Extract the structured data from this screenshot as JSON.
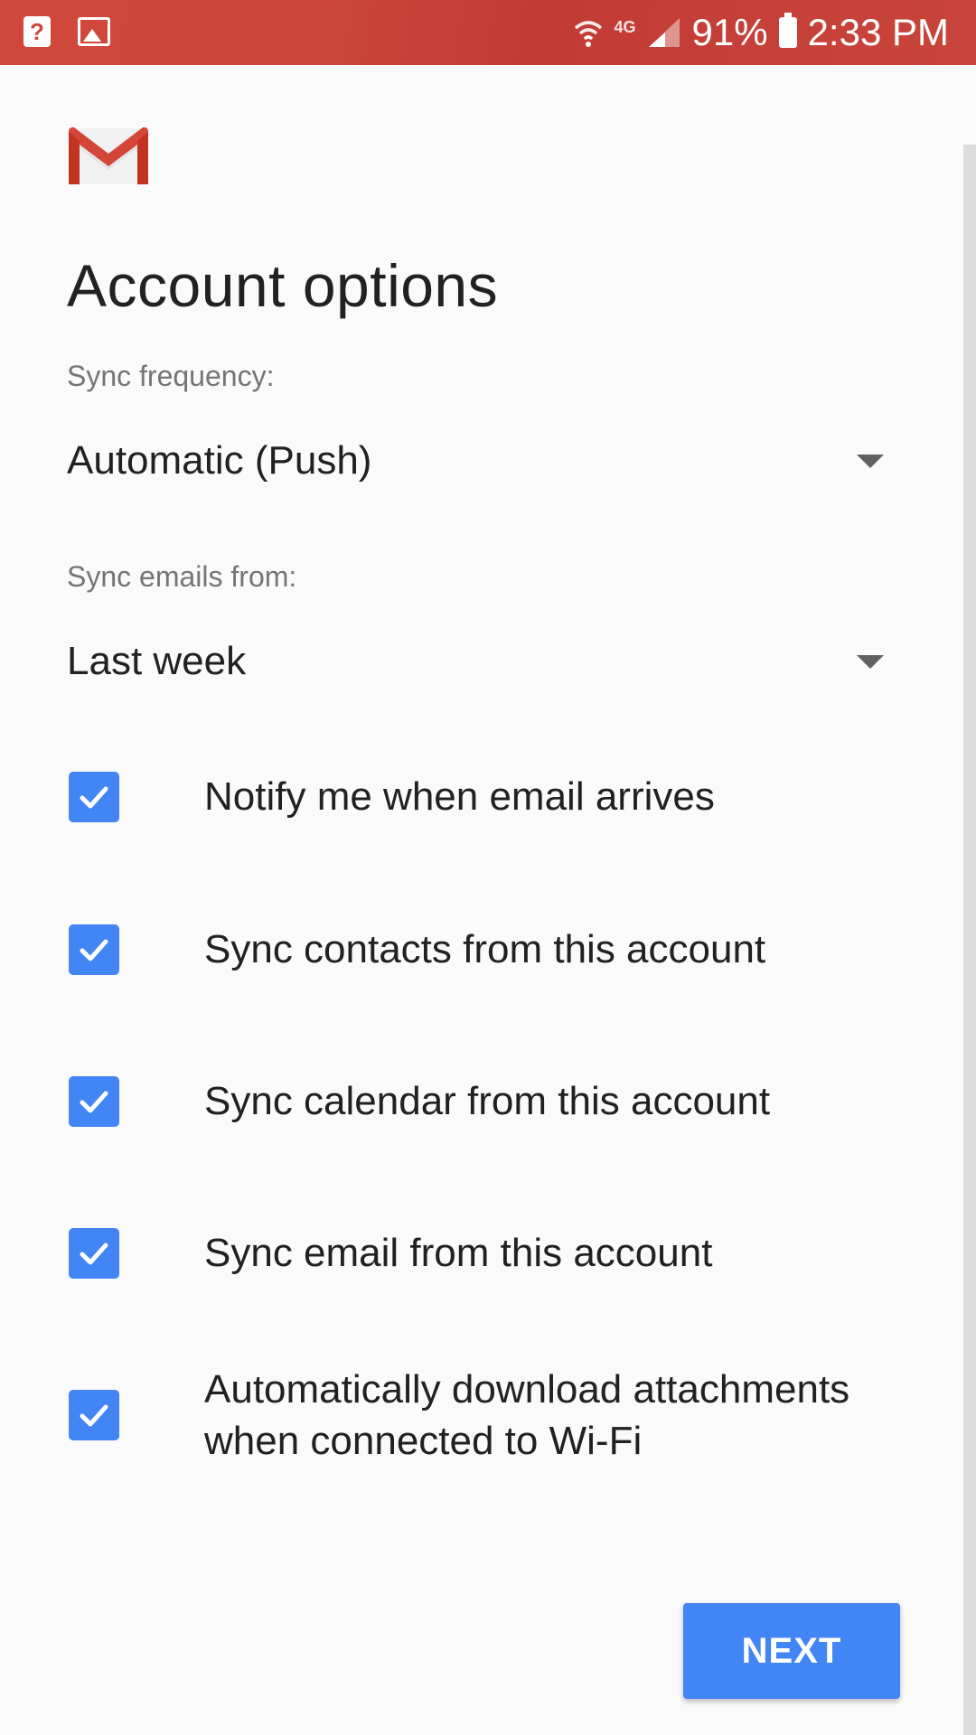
{
  "status_bar": {
    "battery": "91%",
    "time": "2:33 PM",
    "network": "4G"
  },
  "page": {
    "title": "Account options"
  },
  "sync_frequency": {
    "label": "Sync frequency:",
    "value": "Automatic (Push)"
  },
  "sync_emails_from": {
    "label": "Sync emails from:",
    "value": "Last week"
  },
  "options": [
    {
      "label": "Notify me when email arrives",
      "checked": true
    },
    {
      "label": "Sync contacts from this account",
      "checked": true
    },
    {
      "label": "Sync calendar from this account",
      "checked": true
    },
    {
      "label": "Sync email from this account",
      "checked": true
    },
    {
      "label": "Automatically download attachments when connected to Wi-Fi",
      "checked": true
    }
  ],
  "actions": {
    "next_label": "NEXT"
  },
  "colors": {
    "status_bar": "#c9463a",
    "accent": "#4285f4",
    "background": "#fafafa"
  }
}
